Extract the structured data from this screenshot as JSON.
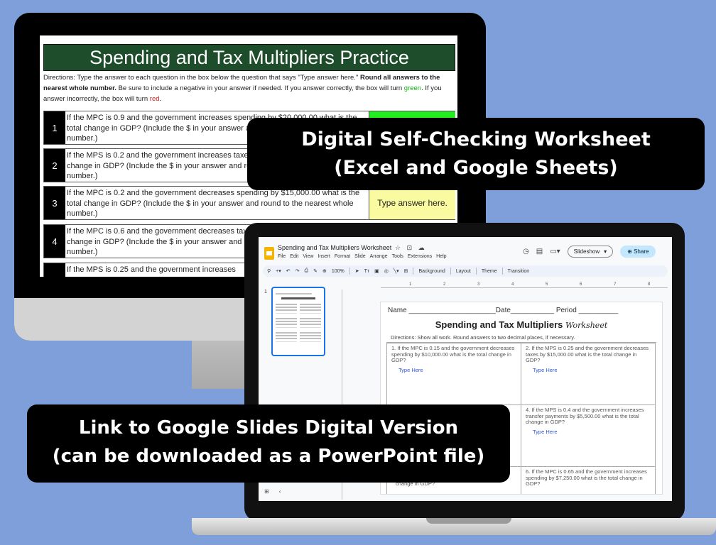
{
  "sheet": {
    "title": "Spending and Tax Multipliers Practice",
    "directions_1": "Directions: Type the answer to each question in the box below the question that says \"Type answer here.\" ",
    "directions_bold": "Round all answers to the nearest whole number.",
    "directions_2": " Be sure to include a negative in your answer if needed. If you answer correctly, the box will turn ",
    "green_word": "green",
    "directions_3": ". If you answer incorrectly, the box will turn ",
    "red_word": "red",
    "directions_4": ".",
    "questions": [
      {
        "num": "1",
        "text": "If the MPC is 0.9 and the government increases spending by $20,000.00 what is the total change in GDP? (Include the $ in your answer and round to the nearest whole number.)",
        "answer": ""
      },
      {
        "num": "2",
        "text": "If the MPS is 0.2 and the government increases taxes by $5,000.00 what is the total change in GDP? (Include the $ in your answer and round to the nearest whole number.)",
        "answer": ""
      },
      {
        "num": "3",
        "text": "If the MPC is 0.2 and the government decreases spending by $15,000.00 what is the total change in GDP? (Include the $ in your answer and round to the nearest whole number.)",
        "answer": "Type answer here."
      },
      {
        "num": "4",
        "text": "If the MPC is 0.6 and the government decreases taxes by $8,000.00 what is the total change in GDP? (Include the $ in your answer and round to the nearest whole number.)",
        "answer": ""
      },
      {
        "num": "",
        "text": "If the MPS is 0.25 and the government increases",
        "answer": ""
      }
    ],
    "colors": {
      "header": "#1e4d2b",
      "correct": "#22ee22",
      "pending": "#fafaa0"
    }
  },
  "slides_app": {
    "doc_title": "Spending and Tax Multipliers Worksheet",
    "title_icons": "☆ ⊡ ☁",
    "menu": [
      "File",
      "Edit",
      "View",
      "Insert",
      "Format",
      "Slide",
      "Arrange",
      "Tools",
      "Extensions",
      "Help"
    ],
    "slideshow_label": "Slideshow",
    "share_label": "Share",
    "zoom": "100%",
    "toolbar_items": [
      "Background",
      "Layout",
      "Theme",
      "Transition"
    ],
    "slide_number": "1",
    "ruler_ticks": [
      "1",
      "2",
      "3",
      "4",
      "5",
      "6",
      "7",
      "8"
    ]
  },
  "worksheet": {
    "name_line": "Name ______________________Date___________ Period __________",
    "title": "Spending and Tax Multipliers ",
    "title_script": "Worksheet",
    "directions": "Directions: Show all work. Round answers to two decimal places, if necessary.",
    "questions": [
      {
        "text": "1.  If the MPC is 0.15 and the government decreases spending by $10,000.00 what is the total change in GDP?",
        "answer": "Type Here"
      },
      {
        "text": "2.  If the MPS is 0.25 and the government decreases taxes by $15,000.00 what is the total change in GDP?",
        "answer": "Type Here"
      },
      {
        "text": "4.  If the MPS is 0.4 and the government increases transfer payments by $5,500.00 what is the total change in GDP?",
        "answer": "Type Here"
      },
      {
        "text": "increases taxes by $25,000.00 what is the total change in GDP?",
        "answer": ""
      },
      {
        "text": "6.  If the MPC is 0.65 and the government increases spending by $7,250.00 what is the total change in GDP?",
        "answer": ""
      }
    ]
  },
  "banners": {
    "top_line1": "Digital Self-Checking Worksheet",
    "top_line2": "(Excel and Google Sheets)",
    "bottom_line1": "Link to Google Slides Digital Version",
    "bottom_line2": "(can be downloaded as a PowerPoint file)"
  }
}
